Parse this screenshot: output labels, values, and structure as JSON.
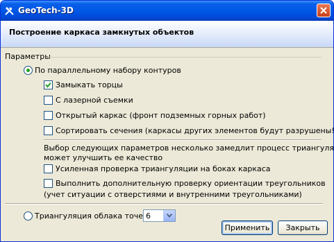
{
  "window": {
    "title": "GeoTech-3D"
  },
  "header": {
    "title": "Построение каркаса замкнутых объектов"
  },
  "group": {
    "label": "Параметры"
  },
  "radio_contours": {
    "label": "По параллельному набору контуров",
    "checked": true
  },
  "options": [
    {
      "label": "Замыкать торцы",
      "checked": true
    },
    {
      "label": "С лазерной съемки",
      "checked": false
    },
    {
      "label": "Открытый каркас (фронт подземных горных работ)",
      "checked": false
    },
    {
      "label": "Сортировать сечения (каркасы других элементов будут разрушены!)",
      "checked": false
    }
  ],
  "note": {
    "line1": "Выбор следующих параметров несколько замедлит процесс триангуляции, но",
    "line2": "может улучшить ее  качество"
  },
  "advanced": [
    {
      "label": "Усиленная проверка триангуляции на боках каркаса",
      "checked": false
    },
    {
      "label_line1": "Выполнить дополнительную проверку ориентации треугольников",
      "label_line2": "(учет ситуации с отверстиями и внутренними треугольниками)",
      "checked": false
    }
  ],
  "radio_cloud": {
    "label": "Триангуляция облака точек",
    "checked": false
  },
  "cloud_select": {
    "value": "6"
  },
  "buttons": {
    "apply": "Применить",
    "close": "Закрыть"
  },
  "colors": {
    "titlebar": "#0058e6",
    "face": "#ece9d8",
    "radio_dot": "#21a121",
    "check": "#21a121"
  }
}
